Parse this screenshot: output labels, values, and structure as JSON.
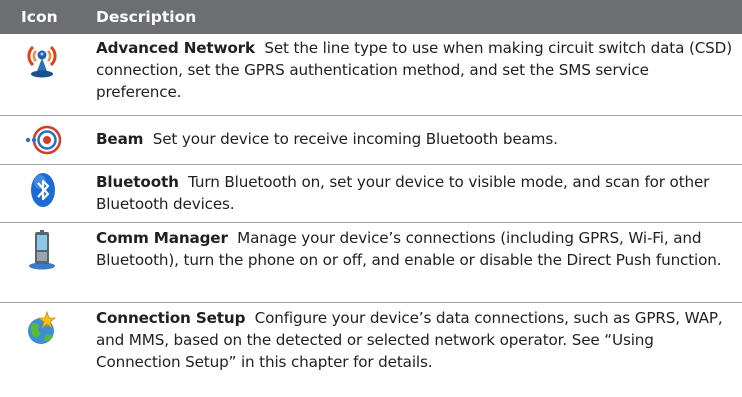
{
  "header": {
    "icon_col": "Icon",
    "desc_col": "Description"
  },
  "rows": [
    {
      "icon": "advanced-network-icon",
      "title": "Advanced Network",
      "text": "Set the line type to use when making circuit switch data (CSD) connection, set the GPRS authentication method, and set the SMS service preference."
    },
    {
      "icon": "beam-icon",
      "title": "Beam",
      "text": "Set your device to receive incoming Bluetooth beams."
    },
    {
      "icon": "bluetooth-icon",
      "title": "Bluetooth",
      "text": "Turn Bluetooth on, set your device to visible mode, and scan for other Bluetooth devices."
    },
    {
      "icon": "comm-manager-icon",
      "title": "Comm Manager",
      "text": "Manage your device’s connections (including GPRS, Wi-Fi, and Bluetooth), turn the phone on or off, and enable or disable the Direct Push function."
    },
    {
      "icon": "connection-setup-icon",
      "title": "Connection Setup",
      "text": "Configure your device’s data connections, such as GPRS, WAP, and MMS, based on the detected or selected network operator. See “Using Connection Setup” in this chapter for details."
    }
  ],
  "colors": {
    "header_bg": "#6d6e71",
    "header_text": "#ffffff",
    "divider": "#9d9fa2",
    "body_text": "#231f20"
  }
}
